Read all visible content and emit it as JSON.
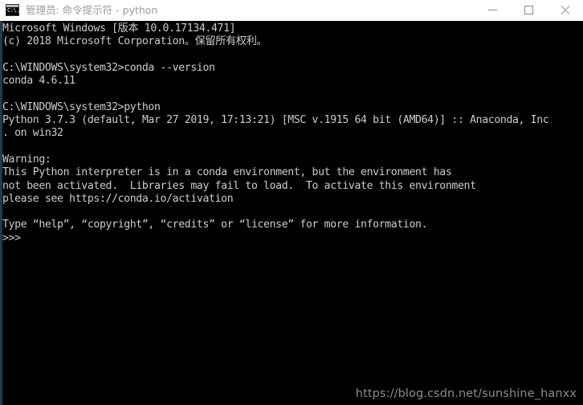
{
  "window": {
    "title": "管理员: 命令提示符 - python",
    "icon": "cmd-icon",
    "icon_glyph": "C:\\.",
    "controls": {
      "minimize": "minimize-icon",
      "maximize": "maximize-icon",
      "close": "close-icon"
    },
    "titlebar_bg": "#ffffff",
    "title_color": "#9a9a9a",
    "console_bg": "#000000",
    "console_fg": "#cccccc",
    "left_border": "#1d3a57"
  },
  "console": {
    "lines": [
      "Microsoft Windows [版本 10.0.17134.471]",
      "(c) 2018 Microsoft Corporation。保留所有权利。",
      "",
      "C:\\WINDOWS\\system32>conda --version",
      "conda 4.6.11",
      "",
      "C:\\WINDOWS\\system32>python",
      "Python 3.7.3 (default, Mar 27 2019, 17:13:21) [MSC v.1915 64 bit (AMD64)] :: Anaconda, Inc",
      ". on win32",
      "",
      "Warning:",
      "This Python interpreter is in a conda environment, but the environment has",
      "not been activated.  Libraries may fail to load.  To activate this environment",
      "please see https://conda.io/activation",
      "",
      "Type “help”, “copyright”, “credits” or “license” for more information.",
      ">>>"
    ],
    "prompt": ">>>",
    "commands": [
      "conda --version",
      "python"
    ],
    "conda_version": "conda 4.6.11",
    "python_version": "Python 3.7.3",
    "windows_version": "10.0.17134.471"
  },
  "watermark": {
    "text": "https://blog.csdn.net/sunshine_hanxx"
  }
}
